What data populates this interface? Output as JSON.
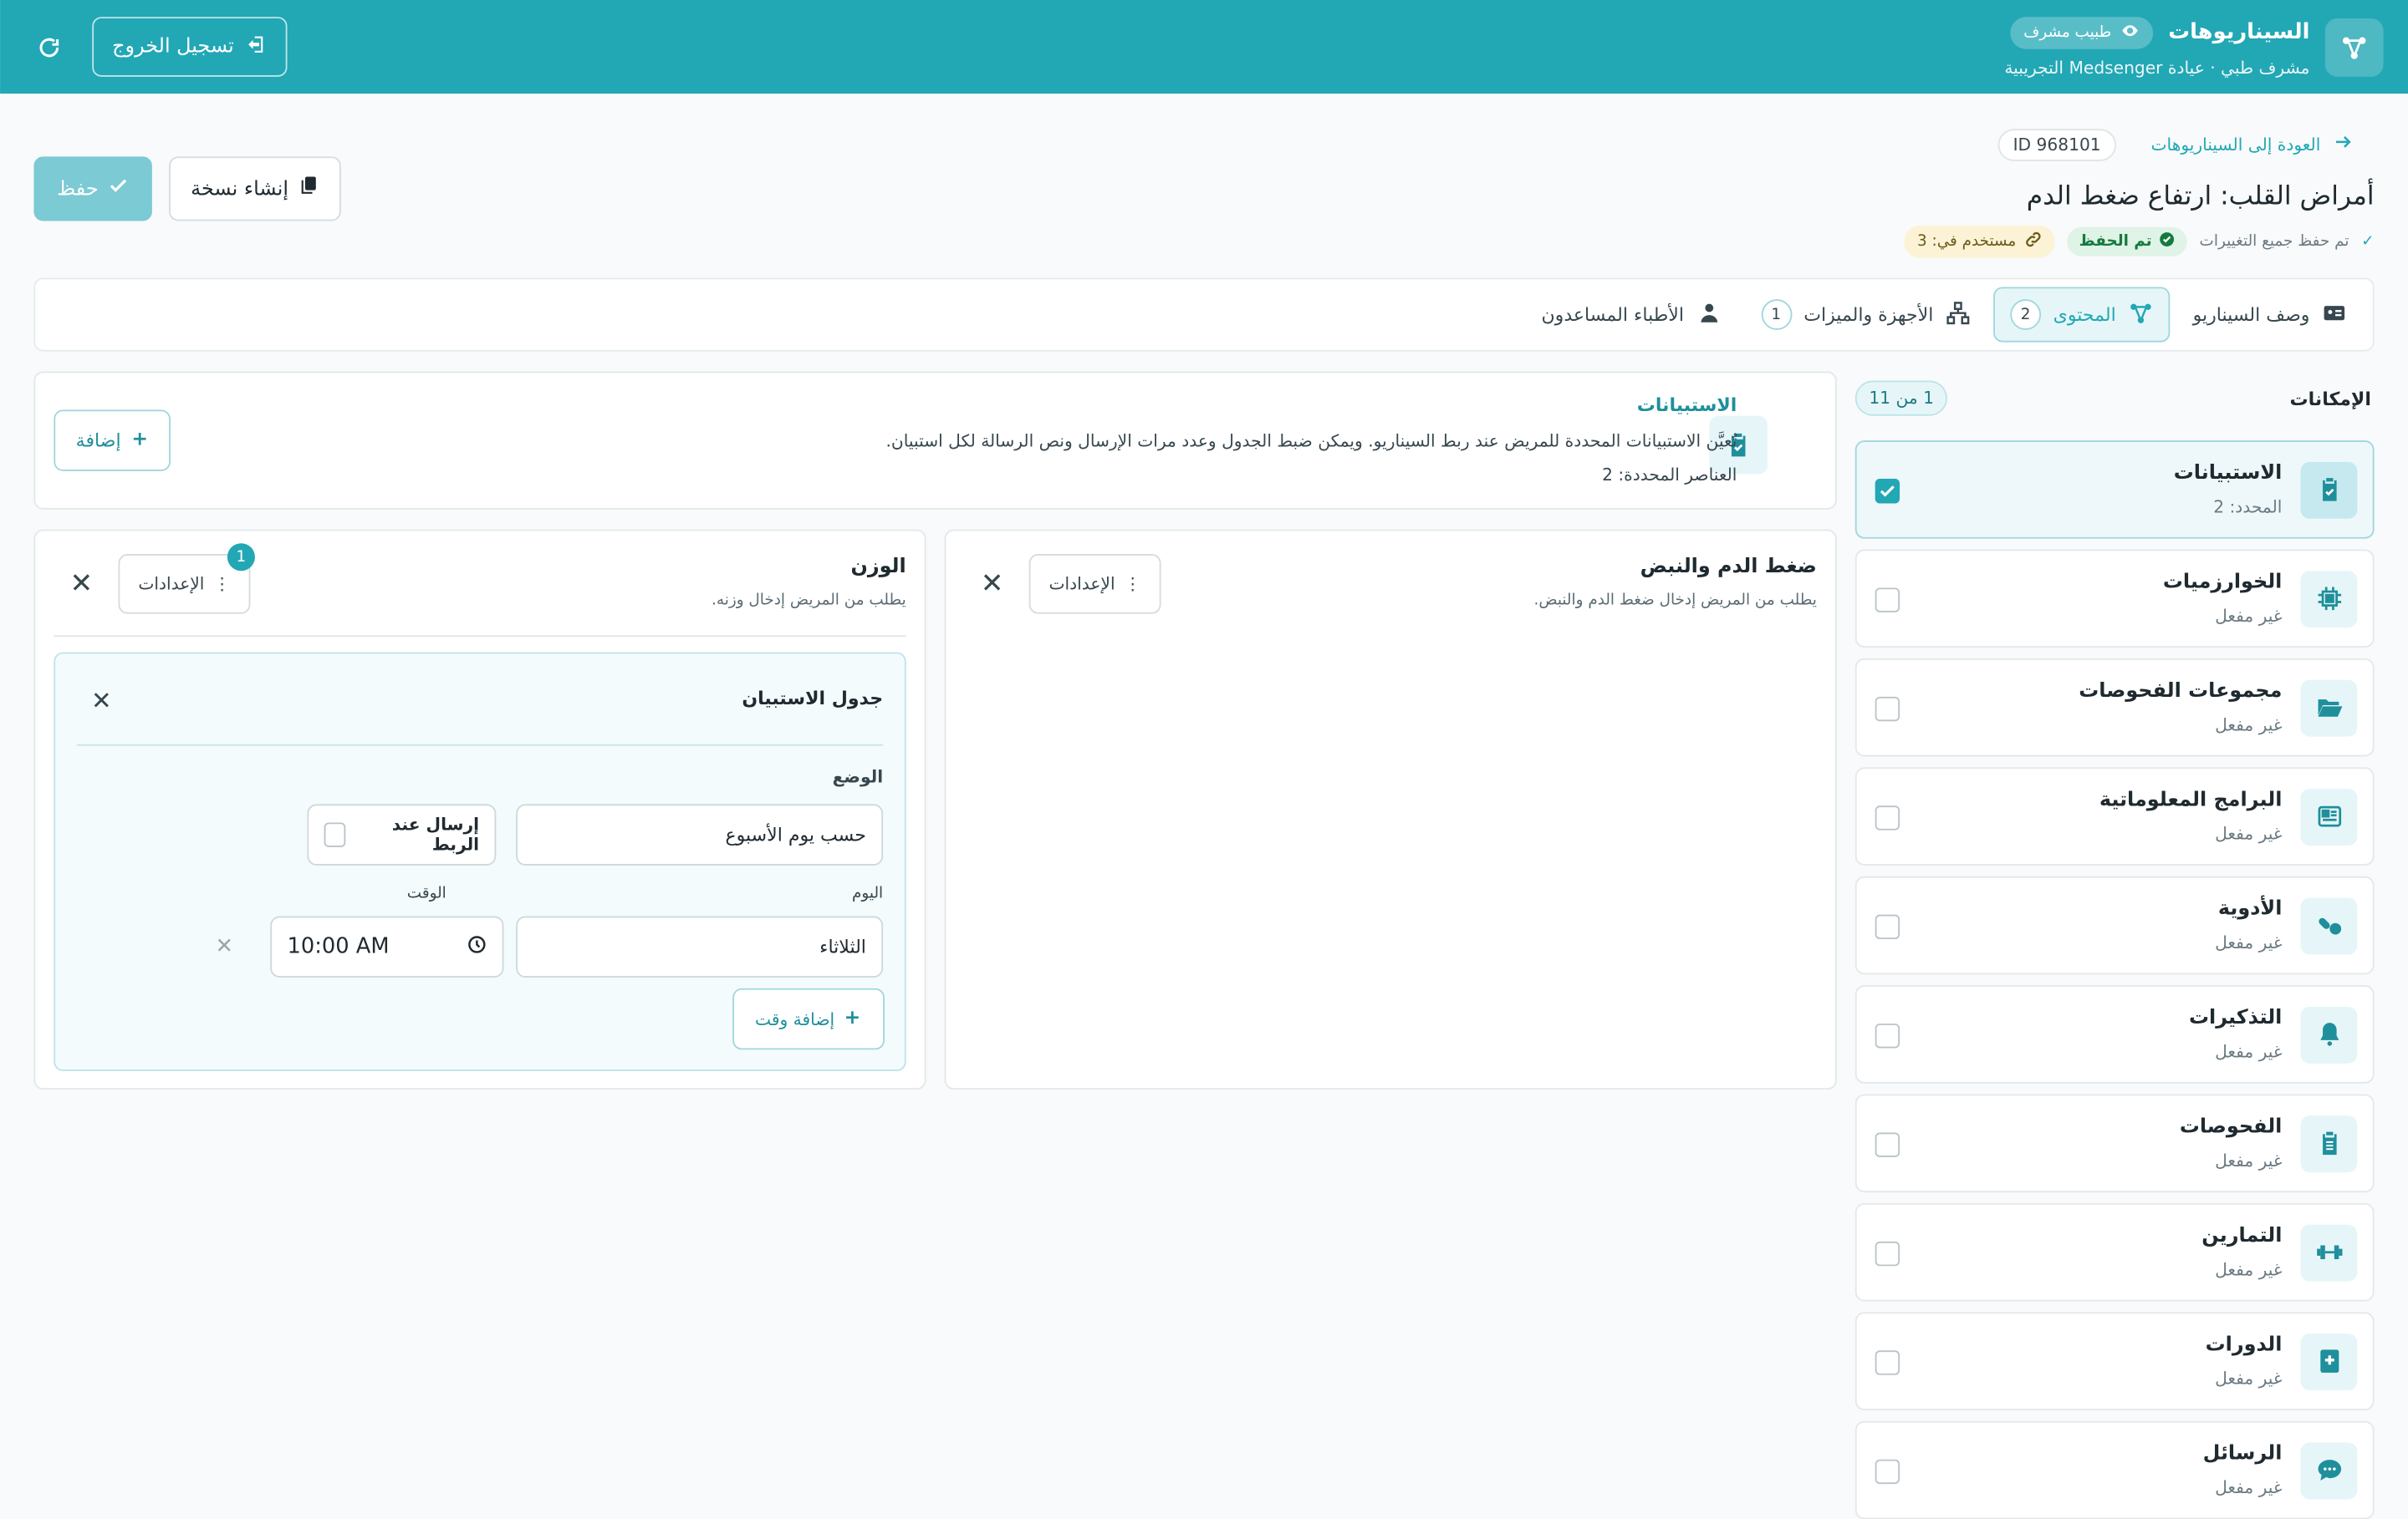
{
  "header": {
    "app_title": "السيناريوهات",
    "role_badge": "طبيب مشرف",
    "subtitle": "مشرف طبي · عيادة Medsenger التجريبية",
    "logout_label": "تسجيل الخروج"
  },
  "page": {
    "back_label": "العودة إلى السيناريوهات",
    "id_label": "ID 968101",
    "title": "أمراض القلب: ارتفاع ضغط الدم",
    "saved_all": "تم حفظ جميع التغييرات",
    "saved_badge": "تم الحفظ",
    "used_in": "مستخدم في: 3",
    "save_label": "حفظ",
    "copy_label": "إنشاء نسخة"
  },
  "tabs": [
    {
      "label": "وصف السيناريو",
      "count": ""
    },
    {
      "label": "المحتوى",
      "count": "2"
    },
    {
      "label": "الأجهزة والميزات",
      "count": "1"
    },
    {
      "label": "الأطباء المساعدون",
      "count": ""
    }
  ],
  "sidebar": {
    "title": "الإمكانات",
    "count": "1 من 11",
    "items": [
      {
        "label": "الاستبيانات",
        "status": "المحدد: 2",
        "icon": "clipboard-check-icon",
        "checked": true
      },
      {
        "label": "الخوارزميات",
        "status": "غير مفعل",
        "icon": "chip-icon",
        "checked": false
      },
      {
        "label": "مجموعات الفحوصات",
        "status": "غير مفعل",
        "icon": "folder-open-icon",
        "checked": false
      },
      {
        "label": "البرامج المعلوماتية",
        "status": "غير مفعل",
        "icon": "newspaper-icon",
        "checked": false
      },
      {
        "label": "الأدوية",
        "status": "غير مفعل",
        "icon": "pills-icon",
        "checked": false
      },
      {
        "label": "التذكيرات",
        "status": "غير مفعل",
        "icon": "bell-icon",
        "checked": false
      },
      {
        "label": "الفحوصات",
        "status": "غير مفعل",
        "icon": "clipboard-list-icon",
        "checked": false
      },
      {
        "label": "التمارين",
        "status": "غير مفعل",
        "icon": "dumbbell-icon",
        "checked": false
      },
      {
        "label": "الدورات",
        "status": "غير مفعل",
        "icon": "book-medical-icon",
        "checked": false
      },
      {
        "label": "الرسائل",
        "status": "غير مفعل",
        "icon": "chat-icon",
        "checked": false
      }
    ]
  },
  "main": {
    "info_title": "الاستبيانات",
    "info_desc": "تُعيَّن الاستبيانات المحددة للمريض عند ربط السيناريو. ويمكن ضبط الجدول وعدد مرات الإرسال ونص الرسالة لكل استبيان.",
    "info_count": "العناصر المحددة: 2",
    "add_label": "إضافة",
    "card1": {
      "title": "ضغط الدم والنبض",
      "desc": "يطلب من المريض إدخال ضغط الدم والنبض.",
      "settings": "الإعدادات"
    },
    "card2": {
      "title": "الوزن",
      "desc": "يطلب من المريض إدخال وزنه.",
      "settings": "الإعدادات",
      "badge": "1"
    },
    "schedule": {
      "title": "جدول الاستبيان",
      "mode_label": "الوضع",
      "mode_value": "حسب يوم الأسبوع",
      "send_on_link": "إرسال عند الربط",
      "day_label": "اليوم",
      "day_value": "الثلاثاء",
      "time_label": "الوقت",
      "time_value": "10:00 AM",
      "add_time": "إضافة وقت"
    }
  },
  "colors": {
    "accent": "#22a7b5",
    "accent_light": "#e6f6f8"
  }
}
